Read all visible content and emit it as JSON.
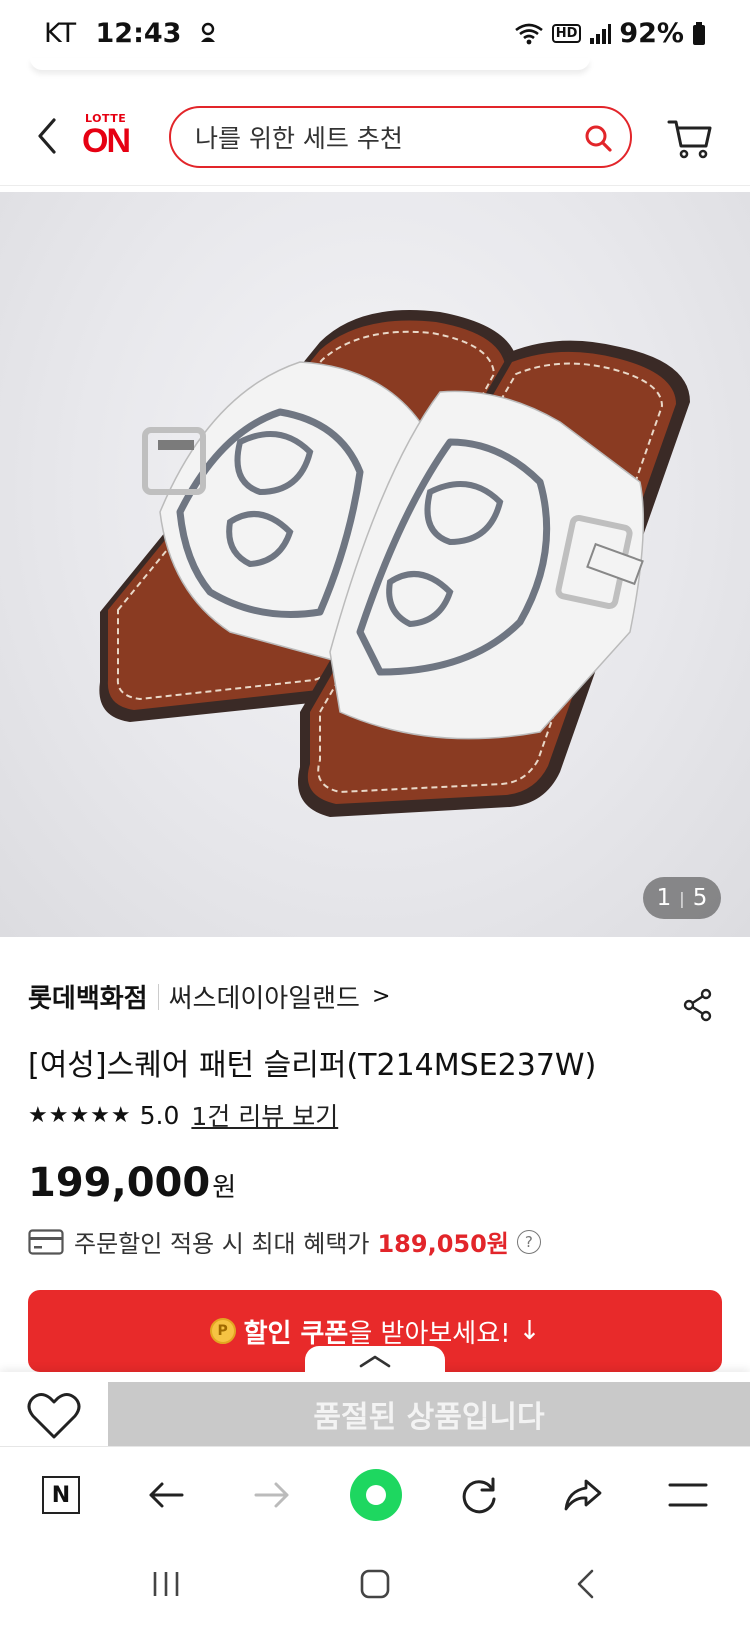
{
  "status_bar": {
    "carrier": "KT",
    "time": "12:43",
    "hd": "HD",
    "battery": "92%"
  },
  "header": {
    "logo_top": "LOTTE",
    "logo_main": "ON",
    "search_placeholder": "나를 위한 세트 추천"
  },
  "gallery": {
    "current": "1",
    "total": "5"
  },
  "product": {
    "store": "롯데백화점",
    "brand": "써스데이아일랜드",
    "brand_chevron": ">",
    "title": "[여성]스퀘어 패턴 슬리퍼(T214MSE237W)",
    "stars": "★★★★★",
    "rating": "5.0",
    "review_link": "1건 리뷰 보기",
    "price": "199,000",
    "price_unit": "원",
    "benefit_label": "주문할인 적용 시 최대 혜택가",
    "benefit_price": "189,050원",
    "help": "?"
  },
  "coupon": {
    "coin": "P",
    "emphasis": "할인 쿠폰",
    "rest": "을 받아보세요!",
    "arrow": "↓"
  },
  "bottom": {
    "soldout_label": "품절된 상품입니다"
  },
  "browser": {
    "n_label": "N"
  },
  "colors": {
    "brand_red": "#e2252a",
    "coupon_red": "#e82a2a",
    "naver_green": "#1ed760",
    "soldout_gray": "#c9c9c9"
  }
}
